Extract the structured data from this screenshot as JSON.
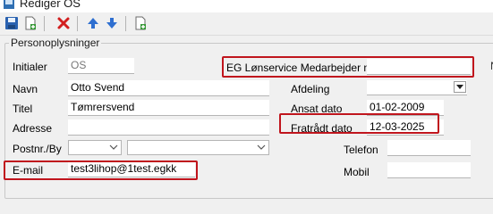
{
  "window": {
    "title": "Rediger OS"
  },
  "toolbar": {
    "buttons": [
      {
        "name": "save-button",
        "icon": "floppy-disk-icon"
      },
      {
        "name": "new-document-button",
        "icon": "new-document-icon"
      },
      {
        "name": "delete-button",
        "icon": "red-x-icon"
      },
      {
        "name": "move-up-button",
        "icon": "arrow-up-icon"
      },
      {
        "name": "move-down-button",
        "icon": "arrow-down-icon"
      },
      {
        "name": "add-document-button",
        "icon": "add-document-icon"
      }
    ]
  },
  "group": {
    "title": "Personoplysninger"
  },
  "form": {
    "initialer": {
      "label": "Initialer",
      "value": "OS"
    },
    "navn": {
      "label": "Navn",
      "value": "Otto Svend"
    },
    "titel": {
      "label": "Titel",
      "value": "Tømrersvend"
    },
    "adresse": {
      "label": "Adresse",
      "value": ""
    },
    "postnr": {
      "label": "Postnr./By",
      "value": "",
      "city": ""
    },
    "email": {
      "label": "E-mail",
      "value": "test3lihop@1test.egkk"
    },
    "medarbejder_nr": {
      "label": "EG Lønservice Medarbejder nr.",
      "value": ""
    },
    "afdeling": {
      "label": "Afdeling",
      "value": ""
    },
    "ansat_dato": {
      "label": "Ansat dato",
      "value": "01-02-2009"
    },
    "fratraadt_dato": {
      "label": "Fratrådt dato",
      "value": "12-03-2025"
    },
    "telefon": {
      "label": "Telefon",
      "value": ""
    },
    "mobil": {
      "label": "Mobil",
      "value": ""
    },
    "right_edge_label": "N"
  },
  "colors": {
    "highlight": "#c0151d",
    "window_bg": "#f0f0f0",
    "field_bg": "#ffffff"
  }
}
